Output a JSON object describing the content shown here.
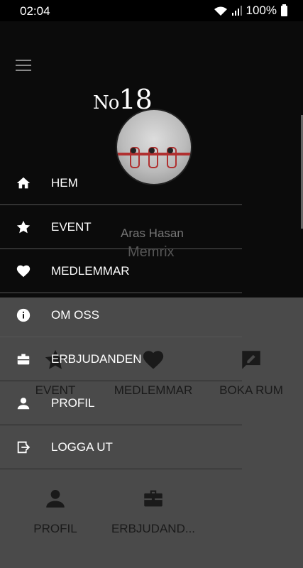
{
  "status_bar": {
    "time": "02:04",
    "battery": "100%"
  },
  "header": {
    "logo_prefix": "No",
    "logo_number": "18"
  },
  "profile": {
    "name": "Aras Hasan",
    "company": "Memrix"
  },
  "home_grid": [
    {
      "label": "EVENT",
      "icon": "star-icon"
    },
    {
      "label": "MEDLEMMAR",
      "icon": "heart-icon"
    },
    {
      "label": "BOKA RUM",
      "icon": "edit-icon"
    },
    {
      "label": "PROFIL",
      "icon": "person-icon"
    },
    {
      "label": "ERBJUDAND...",
      "icon": "briefcase-icon"
    }
  ],
  "drawer": {
    "items": [
      {
        "label": "HEM",
        "icon": "home-icon"
      },
      {
        "label": "EVENT",
        "icon": "star-icon"
      },
      {
        "label": "MEDLEMMAR",
        "icon": "heart-icon"
      },
      {
        "label": "OM OSS",
        "icon": "info-icon"
      },
      {
        "label": "ERBJUDANDEN",
        "icon": "briefcase-icon"
      },
      {
        "label": "PROFIL",
        "icon": "person-icon"
      },
      {
        "label": "LOGGA UT",
        "icon": "logout-icon"
      }
    ]
  },
  "colors": {
    "background": "#000000",
    "sheet": "#4a4a4a",
    "accent": "#b03030"
  }
}
